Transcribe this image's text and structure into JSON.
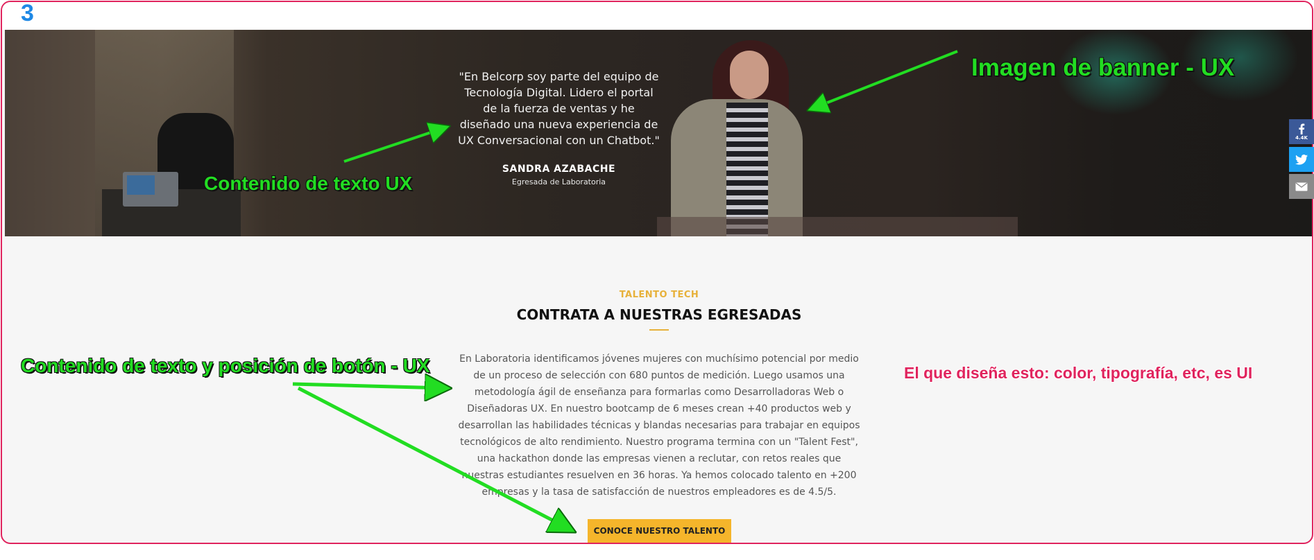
{
  "step_marker": "3",
  "banner": {
    "quote": "\"En Belcorp soy parte del equipo de Tecnología Digital. Lidero el portal de la fuerza de ventas y he diseñado una nueva experiencia de UX Conversacional con un Chatbot.\"",
    "name": "SANDRA AZABACHE",
    "role": "Egresada de Laboratoria"
  },
  "share": {
    "facebook_count": "4.4K",
    "facebook_icon": "facebook-icon",
    "twitter_icon": "twitter-icon",
    "email_icon": "email-icon"
  },
  "section": {
    "eyebrow": "TALENTO TECH",
    "title": "CONTRATA A NUESTRAS EGRESADAS",
    "body": "En Laboratoria identificamos jóvenes mujeres con muchísimo potencial por medio de un proceso de selección con 680 puntos de medición. Luego usamos una metodología ágil de enseñanza para formarlas como Desarrolladoras Web o Diseñadoras UX. En nuestro bootcamp de 6 meses crean +40 productos web y desarrollan las habilidades técnicas y blandas necesarias para trabajar en equipos tecnológicos de alto rendimiento. Nuestro programa termina con un \"Talent Fest\", una hackathon donde las empresas vienen a reclutar, con retos reales que nuestras estudiantes resuelven en 36 horas. Ya hemos colocado talento en +200 empresas y la tasa de satisfacción de nuestros empleadores es de 4.5/5.",
    "cta_label": "CONOCE NUESTRO TALENTO"
  },
  "annotations": {
    "banner_image": "Imagen de banner - UX",
    "text_content": "Contenido de texto UX",
    "text_button_position": "Contenido de texto y posición de botón - UX",
    "ui_note": "El que diseña esto: color, tipografía, etc, es UI"
  },
  "colors": {
    "frame": "#e0245e",
    "accent": "#f5b52b",
    "annotation_green": "#22dd22",
    "facebook": "#3b5998",
    "twitter": "#1da1f2"
  }
}
